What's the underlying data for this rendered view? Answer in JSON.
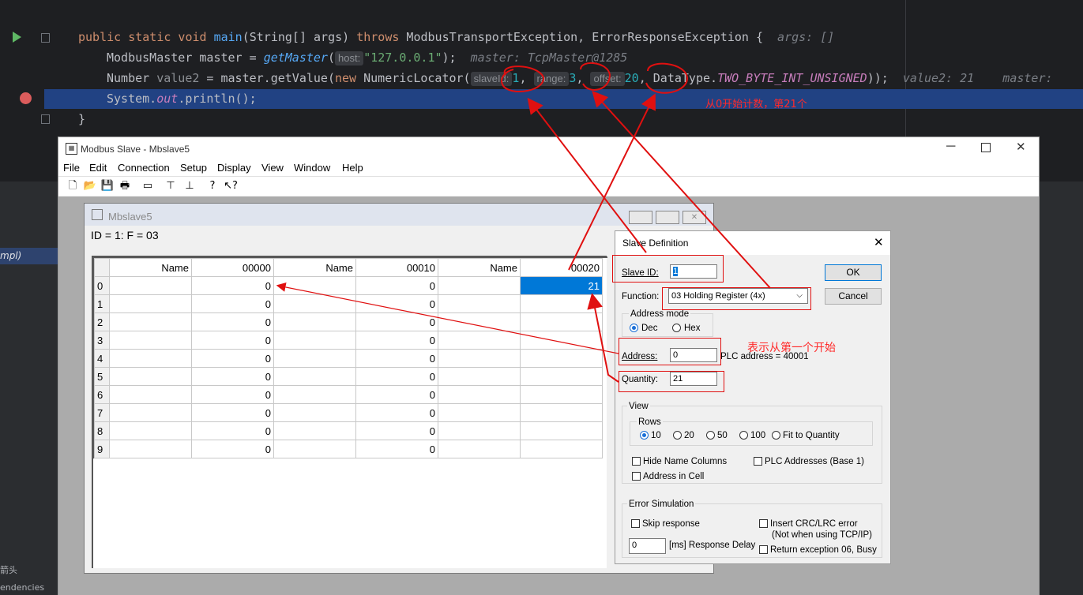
{
  "code": {
    "line1": {
      "kw1": "public static void ",
      "fn": "main",
      "p1": "(String[] args) ",
      "kw2": "throws",
      "p2": " ModbusTransportException, ErrorResponseException {",
      "hint": "args: []"
    },
    "line2": {
      "p1": "ModbusMaster master = ",
      "fn": "getMaster",
      "p2": "(",
      "inl": "host:",
      "str": "\"127.0.0.1\"",
      "p3": ");",
      "hint": "master: TcpMaster@1285"
    },
    "line3": {
      "p1": "Number ",
      "var": "value2",
      "p2": " = master.getValue(",
      "kw": "new",
      "p3": " NumericLocator(",
      "inl1": "slaveId:",
      "n1": "1",
      "c1": ", ",
      "inl2": "range:",
      "n2": "3",
      "c2": ", ",
      "inl3": "offset:",
      "n3": "20",
      "p4": ", DataType.",
      "fld": "TWO_BYTE_INT_UNSIGNED",
      "p5": "));",
      "hint": "value2: 21    master:"
    },
    "line4": {
      "p1": "System.",
      "fld": "out",
      "p2": ".println();"
    },
    "line5": "}"
  },
  "annotations": {
    "count_note": "从0开始计数，第21个",
    "first_note": "表示从第一个开始"
  },
  "left_panel": {
    "item1": "mpl)",
    "bottom1": "箭头",
    "bottom2": "endencies"
  },
  "modbus": {
    "title": "Modbus Slave - Mbslave5",
    "menu": [
      "File",
      "Edit",
      "Connection",
      "Setup",
      "Display",
      "View",
      "Window",
      "Help"
    ],
    "child_title": "Mbslave5",
    "info": "ID = 1: F = 03",
    "headers": [
      "Name",
      "00000",
      "Name",
      "00010",
      "Name",
      "00020"
    ],
    "rows": [
      {
        "i": "0",
        "a": "0",
        "b": "0",
        "c": "21"
      },
      {
        "i": "1",
        "a": "0",
        "b": "0",
        "c": ""
      },
      {
        "i": "2",
        "a": "0",
        "b": "0",
        "c": ""
      },
      {
        "i": "3",
        "a": "0",
        "b": "0",
        "c": ""
      },
      {
        "i": "4",
        "a": "0",
        "b": "0",
        "c": ""
      },
      {
        "i": "5",
        "a": "0",
        "b": "0",
        "c": ""
      },
      {
        "i": "6",
        "a": "0",
        "b": "0",
        "c": ""
      },
      {
        "i": "7",
        "a": "0",
        "b": "0",
        "c": ""
      },
      {
        "i": "8",
        "a": "0",
        "b": "0",
        "c": ""
      },
      {
        "i": "9",
        "a": "0",
        "b": "0",
        "c": ""
      }
    ]
  },
  "dialog": {
    "title": "Slave Definition",
    "slave_id_label": "Slave ID:",
    "slave_id": "1",
    "function_label": "Function:",
    "function": "03 Holding Register (4x)",
    "address_mode": "Address mode",
    "dec": "Dec",
    "hex": "Hex",
    "address_label": "Address:",
    "address": "0",
    "plc_address": "PLC address = 40001",
    "quantity_label": "Quantity:",
    "quantity": "21",
    "ok": "OK",
    "cancel": "Cancel",
    "view": "View",
    "rows": "Rows",
    "r10": "10",
    "r20": "20",
    "r50": "50",
    "r100": "100",
    "fit": "Fit to Quantity",
    "hide_names": "Hide Name Columns",
    "plc_base1": "PLC Addresses (Base 1)",
    "addr_in_cell": "Address in Cell",
    "error_sim": "Error Simulation",
    "skip": "Skip response",
    "crc": "Insert CRC/LRC error",
    "crc2": "(Not when using TCP/IP)",
    "delay_value": "0",
    "delay_label": "[ms] Response Delay",
    "ret06": "Return exception 06, Busy"
  }
}
